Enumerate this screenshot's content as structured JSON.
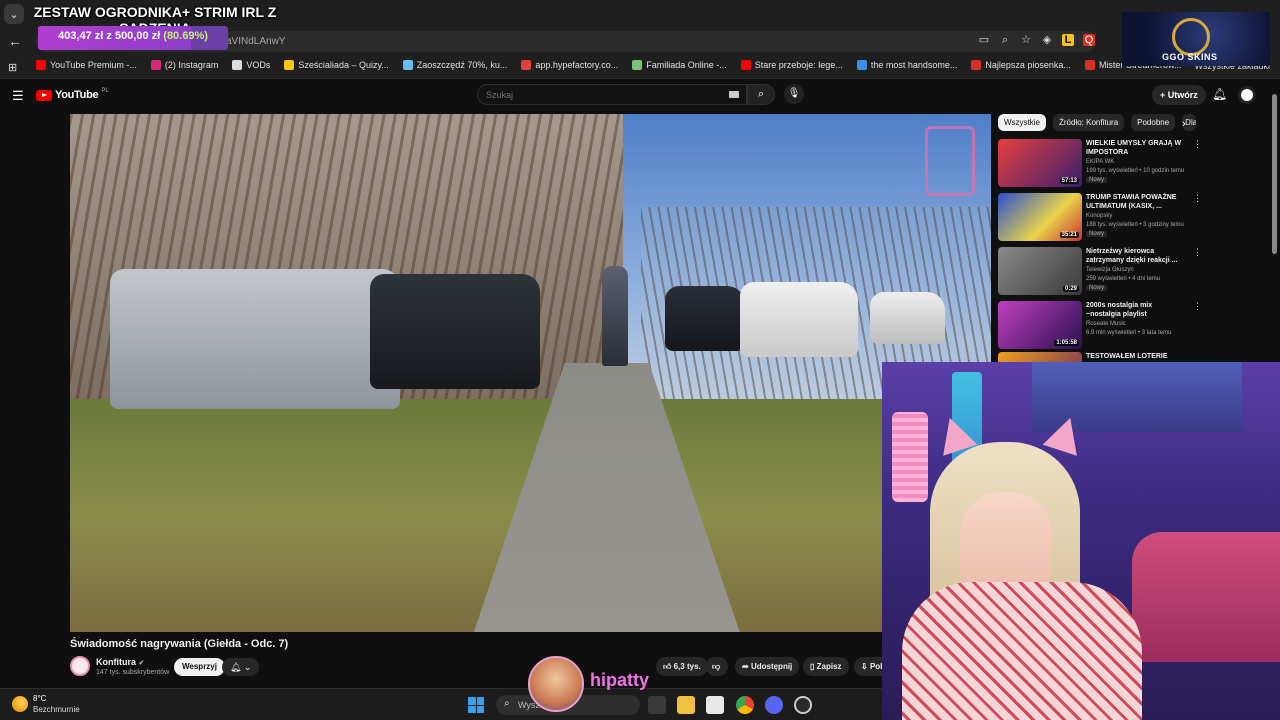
{
  "browser": {
    "url_text": "aVINdLAnwY",
    "bookmarks": [
      {
        "label": "YouTube Premium -...",
        "color": "#ff0000"
      },
      {
        "label": "(2) Instagram",
        "color": "#d62976"
      },
      {
        "label": "VODs",
        "color": "#dddddd"
      },
      {
        "label": "Sześcialiada – Quizy...",
        "color": "#f5c518"
      },
      {
        "label": "Zaoszczędź 70%, ku...",
        "color": "#66c0f4"
      },
      {
        "label": "app.hypefactory.co...",
        "color": "#e04040"
      },
      {
        "label": "Familiada Online -...",
        "color": "#7cc47c"
      },
      {
        "label": "Stare przeboje: lege...",
        "color": "#ff0000"
      },
      {
        "label": "the most handsome...",
        "color": "#3a8ee6"
      },
      {
        "label": "Najlepsza piosenka...",
        "color": "#d93025"
      },
      {
        "label": "Mister Streamerów...",
        "color": "#d93025"
      }
    ],
    "bookmarks_right": "Wszystkie zakładki"
  },
  "overlay": {
    "title": "ZESTAW OGRODNIKA+ STRIM IRL Z SADZENIA",
    "goal_amount": "403,47 zł z 500,00 zł",
    "goal_percent_text": "(80.69%)",
    "goal_fraction": 0.8069,
    "sponsor_text": "GGO SKINS"
  },
  "youtube": {
    "logo_text": "YouTube",
    "region": "PL",
    "search_placeholder": "Szukaj",
    "create_label": "Utwórz",
    "video": {
      "title": "Świadomość nagrywania (Giełda - Odc. 7)",
      "channel": "Konfitura",
      "subscribers": "147 tys. subskrybentów",
      "subscribe_label": "Wesprzyj",
      "likes": "6,3 tys.",
      "share_label": "Udostępnij",
      "save_label": "Zapisz",
      "download_label": "Pobierz"
    },
    "chips": [
      "Wszystkie",
      "Źródło: Konfitura",
      "Podobne",
      "Dla"
    ],
    "recommendations": [
      {
        "title": "WIELKIE UMYSŁY GRAJĄ W IMPOSTORA",
        "channel": "EKIPA WK",
        "meta": "199 tys. wyświetleń • 10 godzin temu",
        "badge": "Nowy",
        "duration": "57:13"
      },
      {
        "title": "TRUMP STAWIA POWAŻNE ULTIMATUM (KASIX, ...",
        "channel": "Konopsky",
        "meta": "188 tys. wyświetleń • 3 godziny temu",
        "badge": "Nowy",
        "duration": "35:21"
      },
      {
        "title": "Nietrzeźwy kierowca zatrzymany dzięki reakcji ...",
        "channel": "Telewizja Głuszyn",
        "meta": "259 wyświetleń • 4 dni temu",
        "badge": "Nowy",
        "duration": "0:29"
      },
      {
        "title": "2000s nostalgia mix ~nostalgia playlist",
        "channel": "Roseate Music",
        "meta": "6,9 mln wyświetleń • 3 lata temu",
        "badge": "",
        "duration": "1:05:58"
      },
      {
        "title": "TESTOWAŁEM LOTERIE PRZEZ",
        "channel": "",
        "meta": "",
        "badge": "",
        "duration": ""
      }
    ]
  },
  "streamer": {
    "name": "hipatty"
  },
  "taskbar": {
    "temperature": "8°C",
    "weather": "Bezchmurnie",
    "search_placeholder": "Wyszukaj"
  }
}
